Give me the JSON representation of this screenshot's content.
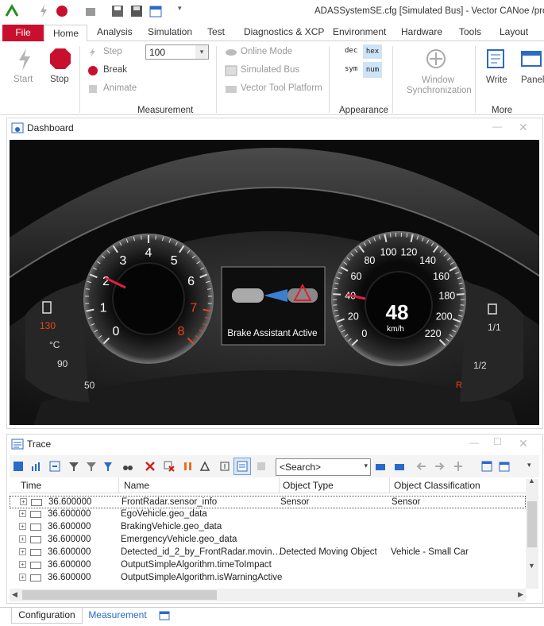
{
  "window": {
    "title": "ADASSystemSE.cfg [Simulated Bus] - Vector CANoe /pro"
  },
  "menu_tabs": [
    "File",
    "Home",
    "Analysis",
    "Simulation",
    "Test",
    "Diagnostics & XCP",
    "Environment",
    "Hardware",
    "Tools",
    "Layout"
  ],
  "ribbon": {
    "start": "Start",
    "stop": "Stop",
    "step": "Step",
    "break": "Break",
    "animate": "Animate",
    "speed_value": "100",
    "online_mode": "Online Mode",
    "simulated_bus": "Simulated Bus",
    "vector_tool_platform": "Vector Tool Platform",
    "measurement_group": "Measurement",
    "fmt_dec": "dec",
    "fmt_hex": "hex",
    "fmt_sym": "sym",
    "fmt_num": "num",
    "appearance_group": "Appearance",
    "window_sync_1": "Window",
    "window_sync_2": "Synchronization",
    "write": "Write",
    "panel": "Panel",
    "more_group": "More"
  },
  "dashboard": {
    "title": "Dashboard",
    "rpm_ticks": [
      "0",
      "1",
      "2",
      "3",
      "4",
      "5",
      "6",
      "7",
      "8"
    ],
    "speed_ticks": [
      "0",
      "20",
      "40",
      "60",
      "80",
      "100",
      "120",
      "140",
      "160",
      "180",
      "200",
      "220"
    ],
    "speed_value": "48",
    "speed_unit": "km/h",
    "center_status": "Brake Assistant Active",
    "temp_labels": [
      "130",
      "°C",
      "90",
      "50"
    ],
    "fuel_labels": [
      "1/1",
      "1/2",
      "R"
    ]
  },
  "trace": {
    "title": "Trace",
    "search_placeholder": "<Search>",
    "columns": [
      "Time",
      "Name",
      "Object Type",
      "Object Classification"
    ],
    "rows": [
      {
        "time": "36.600000",
        "name": "FrontRadar.sensor_info",
        "type": "Sensor",
        "class": "Sensor"
      },
      {
        "time": "36.600000",
        "name": "EgoVehicle.geo_data",
        "type": "",
        "class": ""
      },
      {
        "time": "36.600000",
        "name": "BrakingVehicle.geo_data",
        "type": "",
        "class": ""
      },
      {
        "time": "36.600000",
        "name": "EmergencyVehicle.geo_data",
        "type": "",
        "class": ""
      },
      {
        "time": "36.600000",
        "name": "Detected_id_2_by_FrontRadar.movin…",
        "type": "Detected Moving Object",
        "class": "Vehicle - Small Car"
      },
      {
        "time": "36.600000",
        "name": "OutputSimpleAlgorithm.timeToImpact",
        "type": "",
        "class": ""
      },
      {
        "time": "36.600000",
        "name": "OutputSimpleAlgorithm.isWarningActive",
        "type": "",
        "class": ""
      }
    ]
  },
  "bottom_tabs": [
    "Configuration",
    "Measurement"
  ]
}
